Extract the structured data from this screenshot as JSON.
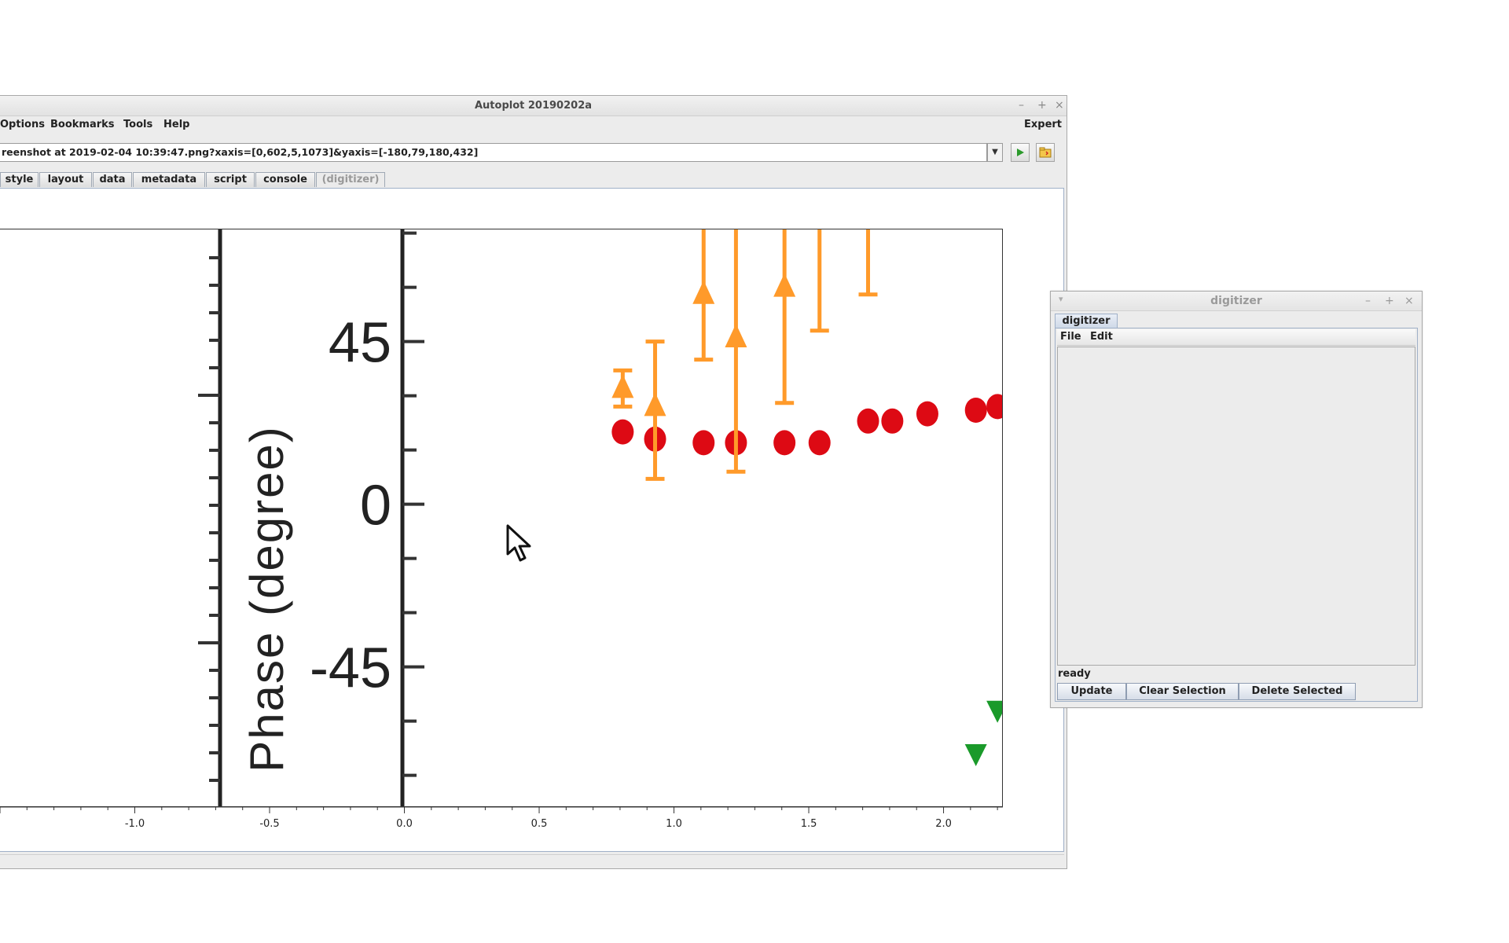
{
  "main_window": {
    "title": "Autoplot 20190202a",
    "menu": [
      "Options",
      "Bookmarks",
      "Tools",
      "Help"
    ],
    "expert_label": "Expert",
    "url_value": "reenshot at 2019-02-04 10:39:47.png?xaxis=[0,602,5,1073]&yaxis=[-180,79,180,432]",
    "tabs": [
      "style",
      "layout",
      "data",
      "metadata",
      "script",
      "console",
      "(digitizer)"
    ],
    "run_icon": "play-icon",
    "browse_icon": "folder-icon"
  },
  "chart_data": {
    "type": "scatter",
    "ylabel": "Phase (degree)",
    "y_tick_labels": [
      "45",
      "0",
      "-45"
    ],
    "x_tick_labels": [
      "-1.0",
      "-0.5",
      "0.0",
      "0.5",
      "1.0",
      "1.5",
      "2.0"
    ],
    "x_ticks": [
      -1.0,
      -0.5,
      0.0,
      0.5,
      1.0,
      1.5,
      2.0
    ],
    "y_ticks": [
      45,
      0,
      -45
    ],
    "xlim": [
      -1.5,
      2.22
    ],
    "ylim": [
      -84,
      76
    ],
    "colors": {
      "red": "#dd0a14",
      "orange": "#ff9a2a",
      "green": "#1a9a2a"
    },
    "series": [
      {
        "marker": "circle",
        "color": "#dd0a14",
        "x": [
          0.81,
          0.93,
          1.11,
          1.23,
          1.41,
          1.54,
          1.72,
          1.81,
          1.94,
          2.12,
          2.2
        ],
        "y": [
          20,
          18,
          17,
          17,
          17,
          17,
          23,
          23,
          25,
          26,
          27
        ]
      },
      {
        "marker": "triangle-up",
        "color": "#ff9a2a",
        "x": [
          0.81,
          0.93,
          1.11,
          1.23,
          1.41,
          1.54,
          1.72
        ],
        "y": [
          32,
          27,
          58,
          46,
          60,
          80,
          80
        ],
        "yerr_low": [
          27,
          7,
          40,
          9,
          28,
          48,
          58
        ],
        "yerr_high": [
          37,
          45,
          78,
          78,
          78,
          78,
          78
        ]
      },
      {
        "marker": "triangle-down",
        "color": "#1a9a2a",
        "x": [
          2.12,
          2.2
        ],
        "y": [
          -69,
          -57
        ]
      }
    ]
  },
  "digitizer": {
    "title": "digitizer",
    "tab_label": "digitizer",
    "menu": [
      "File",
      "Edit"
    ],
    "status": "ready",
    "buttons": [
      "Update",
      "Clear Selection",
      "Delete Selected"
    ]
  }
}
